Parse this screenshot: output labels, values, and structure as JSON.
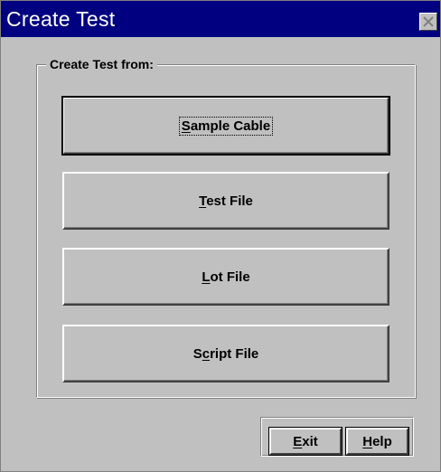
{
  "window": {
    "title": "Create Test"
  },
  "group": {
    "label": "Create Test from:"
  },
  "buttons": [
    {
      "pre": "",
      "mnemonic": "S",
      "post": "ample Cable"
    },
    {
      "pre": "",
      "mnemonic": "T",
      "post": "est File"
    },
    {
      "pre": "",
      "mnemonic": "L",
      "post": "ot File"
    },
    {
      "pre": "S",
      "mnemonic": "c",
      "post": "ript File"
    }
  ],
  "footer": {
    "exit": {
      "mnemonic": "E",
      "post": "xit"
    },
    "help": {
      "mnemonic": "H",
      "post": "elp"
    }
  },
  "colors": {
    "titlebar": "#000080",
    "face": "#c0c0c0"
  }
}
